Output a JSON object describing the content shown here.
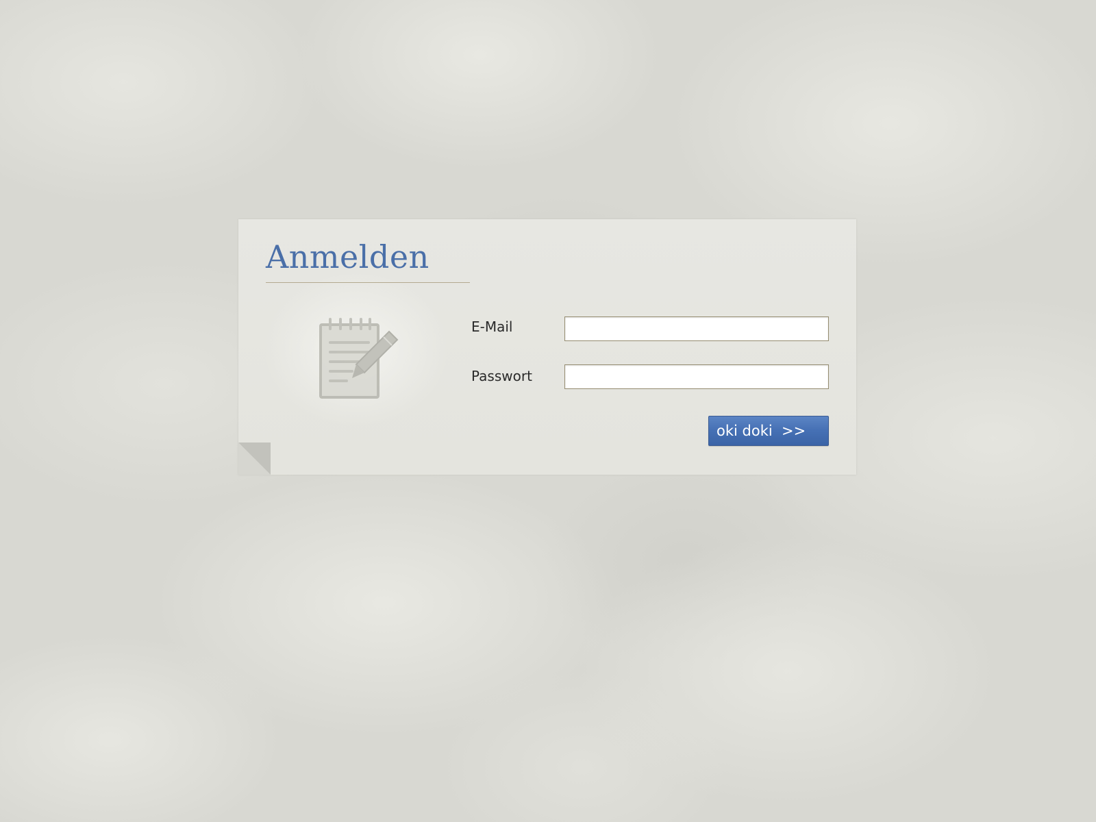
{
  "login": {
    "title": "Anmelden",
    "email_label": "E-Mail",
    "email_value": "",
    "password_label": "Passwort",
    "password_value": "",
    "submit_label": "oki doki  >>"
  },
  "icons": {
    "illustration": "notepad-pencil-icon",
    "corner": "page-curl"
  },
  "colors": {
    "title": "#4a6fa8",
    "button": "#4570b4",
    "card": "#e6e6e0",
    "background": "#d8d8d2"
  }
}
